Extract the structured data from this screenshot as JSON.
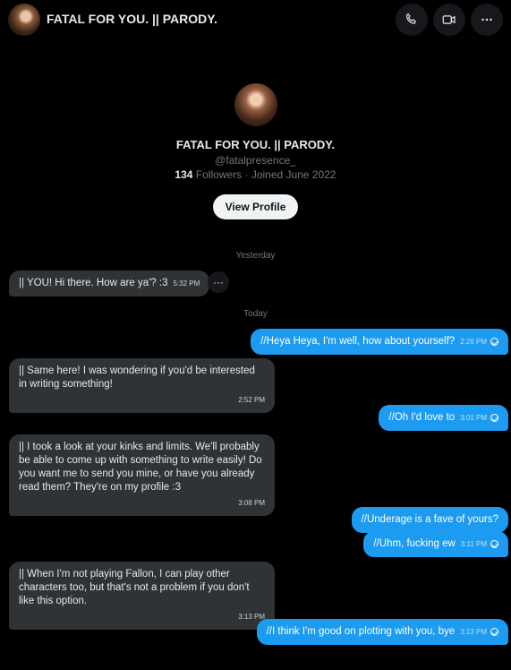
{
  "header": {
    "title": "FATAL FOR YOU. || PARODY.",
    "icons": [
      "phone-icon",
      "video-icon",
      "more-icon"
    ]
  },
  "profile": {
    "name": "FATAL FOR YOU. || PARODY.",
    "handle": "@fatalpresence_",
    "followers_count": "134",
    "followers_label": "Followers",
    "joined": "· Joined June 2022",
    "view_button": "View Profile"
  },
  "days": {
    "yesterday": "Yesterday",
    "today": "Today"
  },
  "messages": [
    {
      "dir": "in",
      "text": "|| YOU! Hi there. How are ya'? :3",
      "time": "5:32 PM"
    },
    {
      "dir": "out",
      "text": "//Heya Heya, I'm well, how about yourself?",
      "time": "2:26 PM"
    },
    {
      "dir": "in",
      "text": "|| Same here! I was wondering if you'd be interested in writing something!",
      "time": "2:52 PM"
    },
    {
      "dir": "out",
      "text": "//Oh I'd love to",
      "time": "3:01 PM"
    },
    {
      "dir": "in",
      "text": "|| I took a look at your kinks and limits. We'll probably be able to come up with something to write easily! Do you want me to send you mine, or have you already read them? They're on my profile :3",
      "time": "3:08 PM"
    },
    {
      "dir": "out",
      "text": "//Underage is a fave of yours?",
      "time": ""
    },
    {
      "dir": "out",
      "text": "//Uhm, fucking ew",
      "time": "3:11 PM"
    },
    {
      "dir": "in",
      "text": "|| When I'm not playing Fallon, I can play other characters too, but that's not a problem if you don't like this option.",
      "time": "3:13 PM"
    },
    {
      "dir": "out",
      "text": "//I think I'm good on plotting with you, bye",
      "time": "3:13 PM"
    }
  ],
  "colors": {
    "background": "#000000",
    "incoming_bubble": "#2f3336",
    "outgoing_bubble": "#1d9bf0"
  }
}
